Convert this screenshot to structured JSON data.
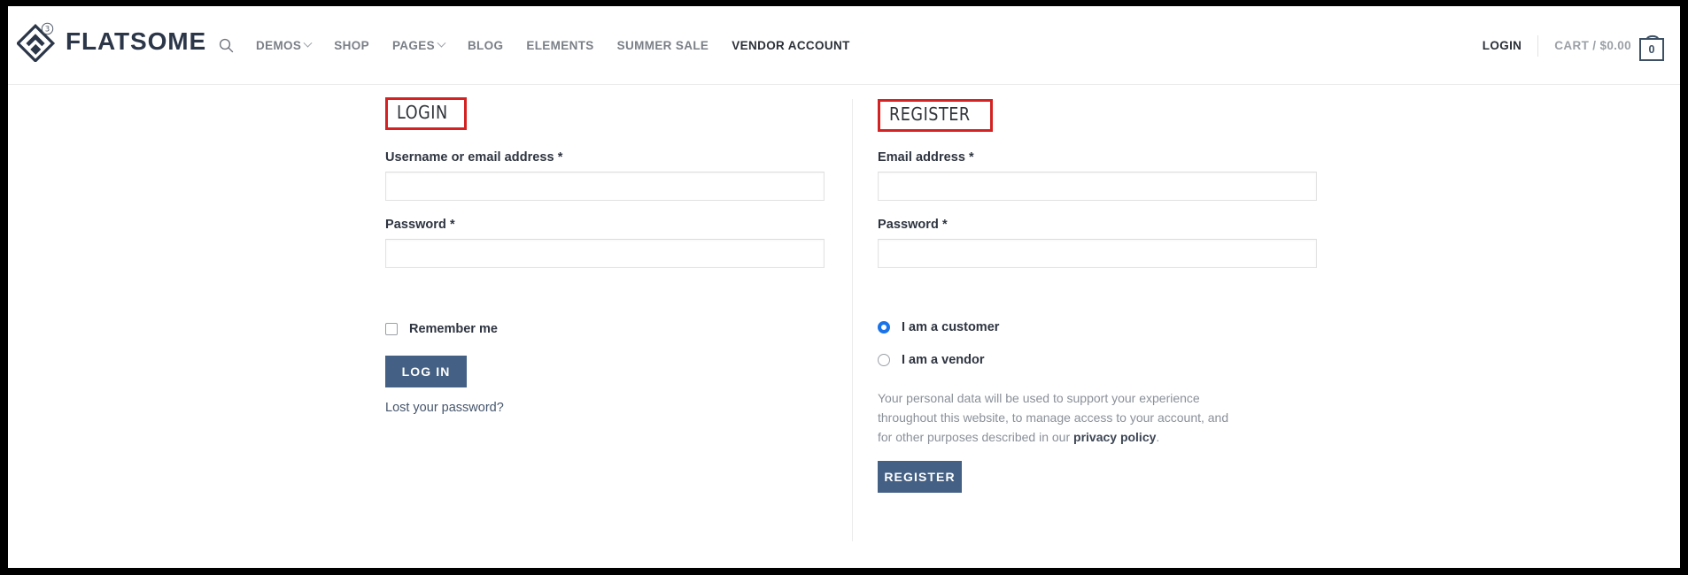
{
  "header": {
    "brand_name": "FLATSOME",
    "logo_badge": "3",
    "search_icon": "search-icon",
    "nav_items": [
      {
        "label": "DEMOS",
        "has_caret": true,
        "active": false
      },
      {
        "label": "SHOP",
        "has_caret": false,
        "active": false
      },
      {
        "label": "PAGES",
        "has_caret": true,
        "active": false
      },
      {
        "label": "BLOG",
        "has_caret": false,
        "active": false
      },
      {
        "label": "ELEMENTS",
        "has_caret": false,
        "active": false
      },
      {
        "label": "SUMMER SALE",
        "has_caret": false,
        "active": false
      },
      {
        "label": "VENDOR ACCOUNT",
        "has_caret": false,
        "active": true
      }
    ],
    "login_label": "LOGIN",
    "cart_label": "CART / $0.00",
    "cart_count": "0",
    "cart_icon": "shopping-bag-icon"
  },
  "login_panel": {
    "title": "LOGIN",
    "username_label": "Username or email address *",
    "username_value": "",
    "username_placeholder": "",
    "password_label": "Password *",
    "password_value": "",
    "password_placeholder": "",
    "remember_label": "Remember me",
    "remember_checked": false,
    "submit_label": "LOG IN",
    "lost_password_label": "Lost your password?"
  },
  "register_panel": {
    "title": "REGISTER",
    "email_label": "Email address *",
    "email_value": "",
    "email_placeholder": "",
    "password_label": "Password *",
    "password_value": "",
    "password_placeholder": "",
    "account_types": [
      {
        "label": "I am a customer",
        "selected": true
      },
      {
        "label": "I am a vendor",
        "selected": false
      }
    ],
    "privacy_text": "Your personal data will be used to support your experience throughout this website, to manage access to your account, and for other purposes described in our ",
    "privacy_link_text": "privacy policy",
    "privacy_text_end": ".",
    "submit_label": "REGISTER"
  },
  "annotations": {
    "box_color": "#d42222",
    "boxed_elements": [
      "login-title",
      "register-title"
    ]
  },
  "colors": {
    "accent_button": "#446084",
    "nav_text": "#7a7f87",
    "nav_active": "#2b3038",
    "brand": "#2b3648",
    "annotation_red": "#d42222",
    "radio_selected": "#1a73e8"
  }
}
